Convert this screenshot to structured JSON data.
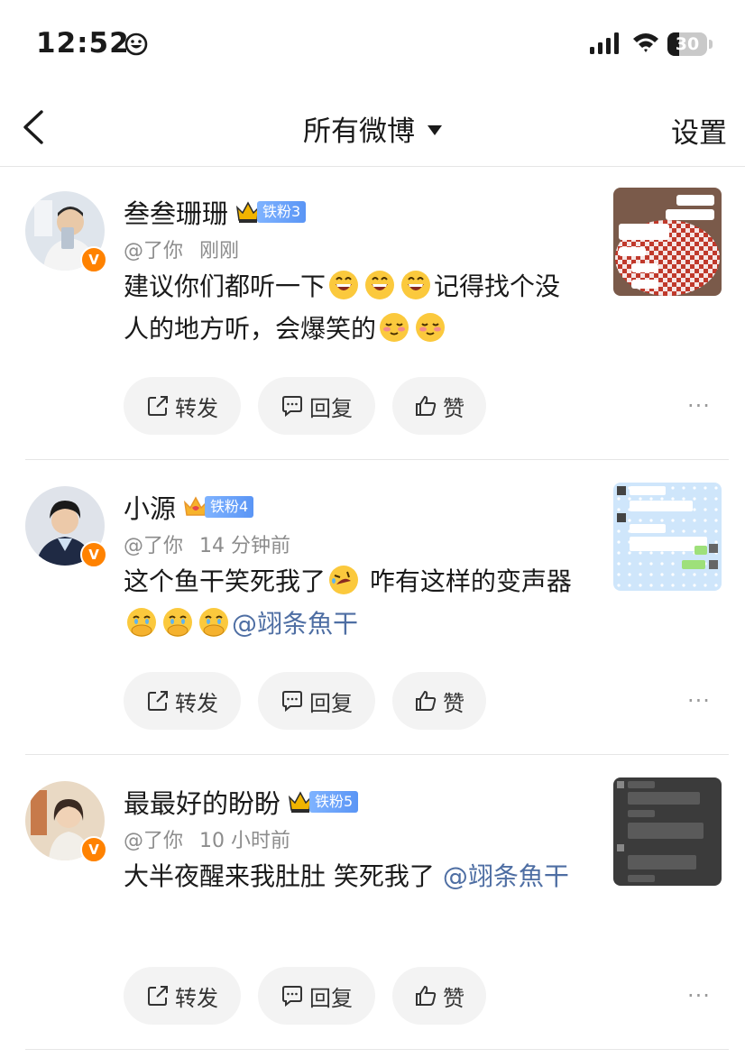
{
  "status_bar": {
    "time": "12:52",
    "battery": "30",
    "battery_level": 0.3
  },
  "nav": {
    "title": "所有微博",
    "settings": "设置"
  },
  "comments": [
    {
      "username": "叁叁珊珊",
      "fan_badge": "铁粉3",
      "mention": "@了你",
      "time": "刚刚",
      "text_before": "建议你们都听一下",
      "text_mid": "记得找个没人的地方听，会爆笑的",
      "text_mention": "",
      "avatar_color": "#c7d3e0",
      "thumb_theme": "checkered"
    },
    {
      "username": "小源",
      "fan_badge": "铁粉4",
      "mention": "@了你",
      "time": "14 分钟前",
      "text_before": "这个鱼干笑死我了",
      "text_mid": "咋有这样的变声器",
      "text_mention": "@翊条魚干",
      "avatar_color": "#26334a",
      "thumb_theme": "blue-dots"
    },
    {
      "username": "最最好的盼盼",
      "fan_badge": "铁粉5",
      "mention": "@了你",
      "time": "10 小时前",
      "text_before": "大半夜醒来我肚肚 笑死我了 ",
      "text_mid": "",
      "text_mention": "@翊条魚干",
      "avatar_color": "#d9b99b",
      "thumb_theme": "dark"
    }
  ],
  "actions": {
    "repost": "转发",
    "reply": "回复",
    "like": "赞",
    "more": "···"
  }
}
